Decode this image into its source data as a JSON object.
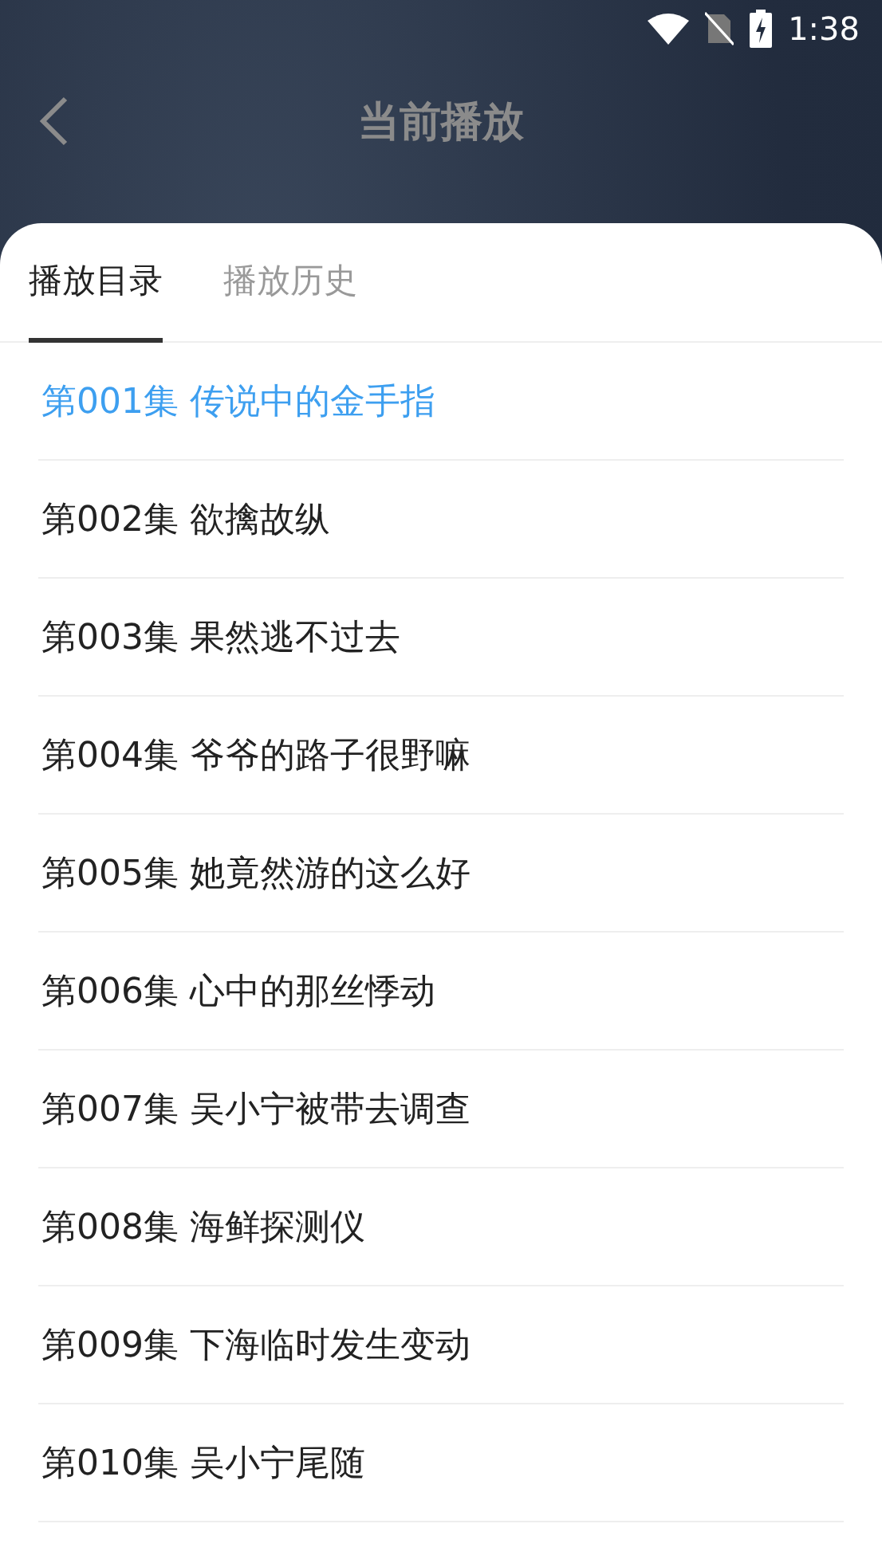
{
  "status_bar": {
    "time": "1:38"
  },
  "header": {
    "title": "当前播放"
  },
  "tabs": [
    {
      "label": "播放目录",
      "selected": true
    },
    {
      "label": "播放历史",
      "selected": false
    }
  ],
  "episodes": [
    {
      "title": "第001集 传说中的金手指",
      "selected": true
    },
    {
      "title": "第002集 欲擒故纵",
      "selected": false
    },
    {
      "title": "第003集 果然逃不过去",
      "selected": false
    },
    {
      "title": "第004集 爷爷的路子很野嘛",
      "selected": false
    },
    {
      "title": "第005集 她竟然游的这么好",
      "selected": false
    },
    {
      "title": "第006集 心中的那丝悸动",
      "selected": false
    },
    {
      "title": "第007集 吴小宁被带去调查",
      "selected": false
    },
    {
      "title": "第008集 海鲜探测仪",
      "selected": false
    },
    {
      "title": "第009集 下海临时发生变动",
      "selected": false
    },
    {
      "title": "第010集 吴小宁尾随",
      "selected": false
    }
  ]
}
